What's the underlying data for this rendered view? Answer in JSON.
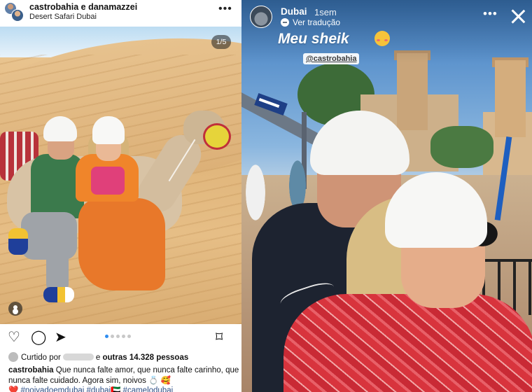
{
  "post": {
    "header": {
      "usernames": "castrobahia e danamazzei",
      "location": "Desert Safari Dubai",
      "more_icon": "more-horizontal-icon",
      "more_label": "•••"
    },
    "carousel": {
      "counter": "1/5",
      "current_slide": 1,
      "total_slides": 5
    },
    "actions": {
      "heart_icon": "heart-icon",
      "heart_glyph": "♡",
      "comment_icon": "comment-icon",
      "comment_glyph": "◯",
      "share_icon": "share-icon",
      "share_glyph": "➤",
      "save_icon": "bookmark-icon",
      "save_glyph": "⌑"
    },
    "likes": {
      "prefix": "Curtido por",
      "and_others": "e",
      "others_count": "outras 14.328 pessoas"
    },
    "caption": {
      "username": "castrobahia",
      "text": "Que nunca falte amor, que nunca falte carinho, que nunca falte cuidado. Agora sim, noivos 💍 🥰"
    },
    "hashtags": "❤️ #noivadoemdubai #dubai🇦🇪 #camelodubai"
  },
  "story": {
    "account": "Dubai",
    "time": "1sem",
    "translate": "Ver tradução",
    "more_label": "•••",
    "text": "Meu sheik",
    "emoji": "smiling-face-with-hearts-icon",
    "mention": "@castrobahia"
  },
  "colors": {
    "link_blue": "#2d4e85",
    "active_dot": "#2f8df0",
    "white": "#ffffff"
  }
}
